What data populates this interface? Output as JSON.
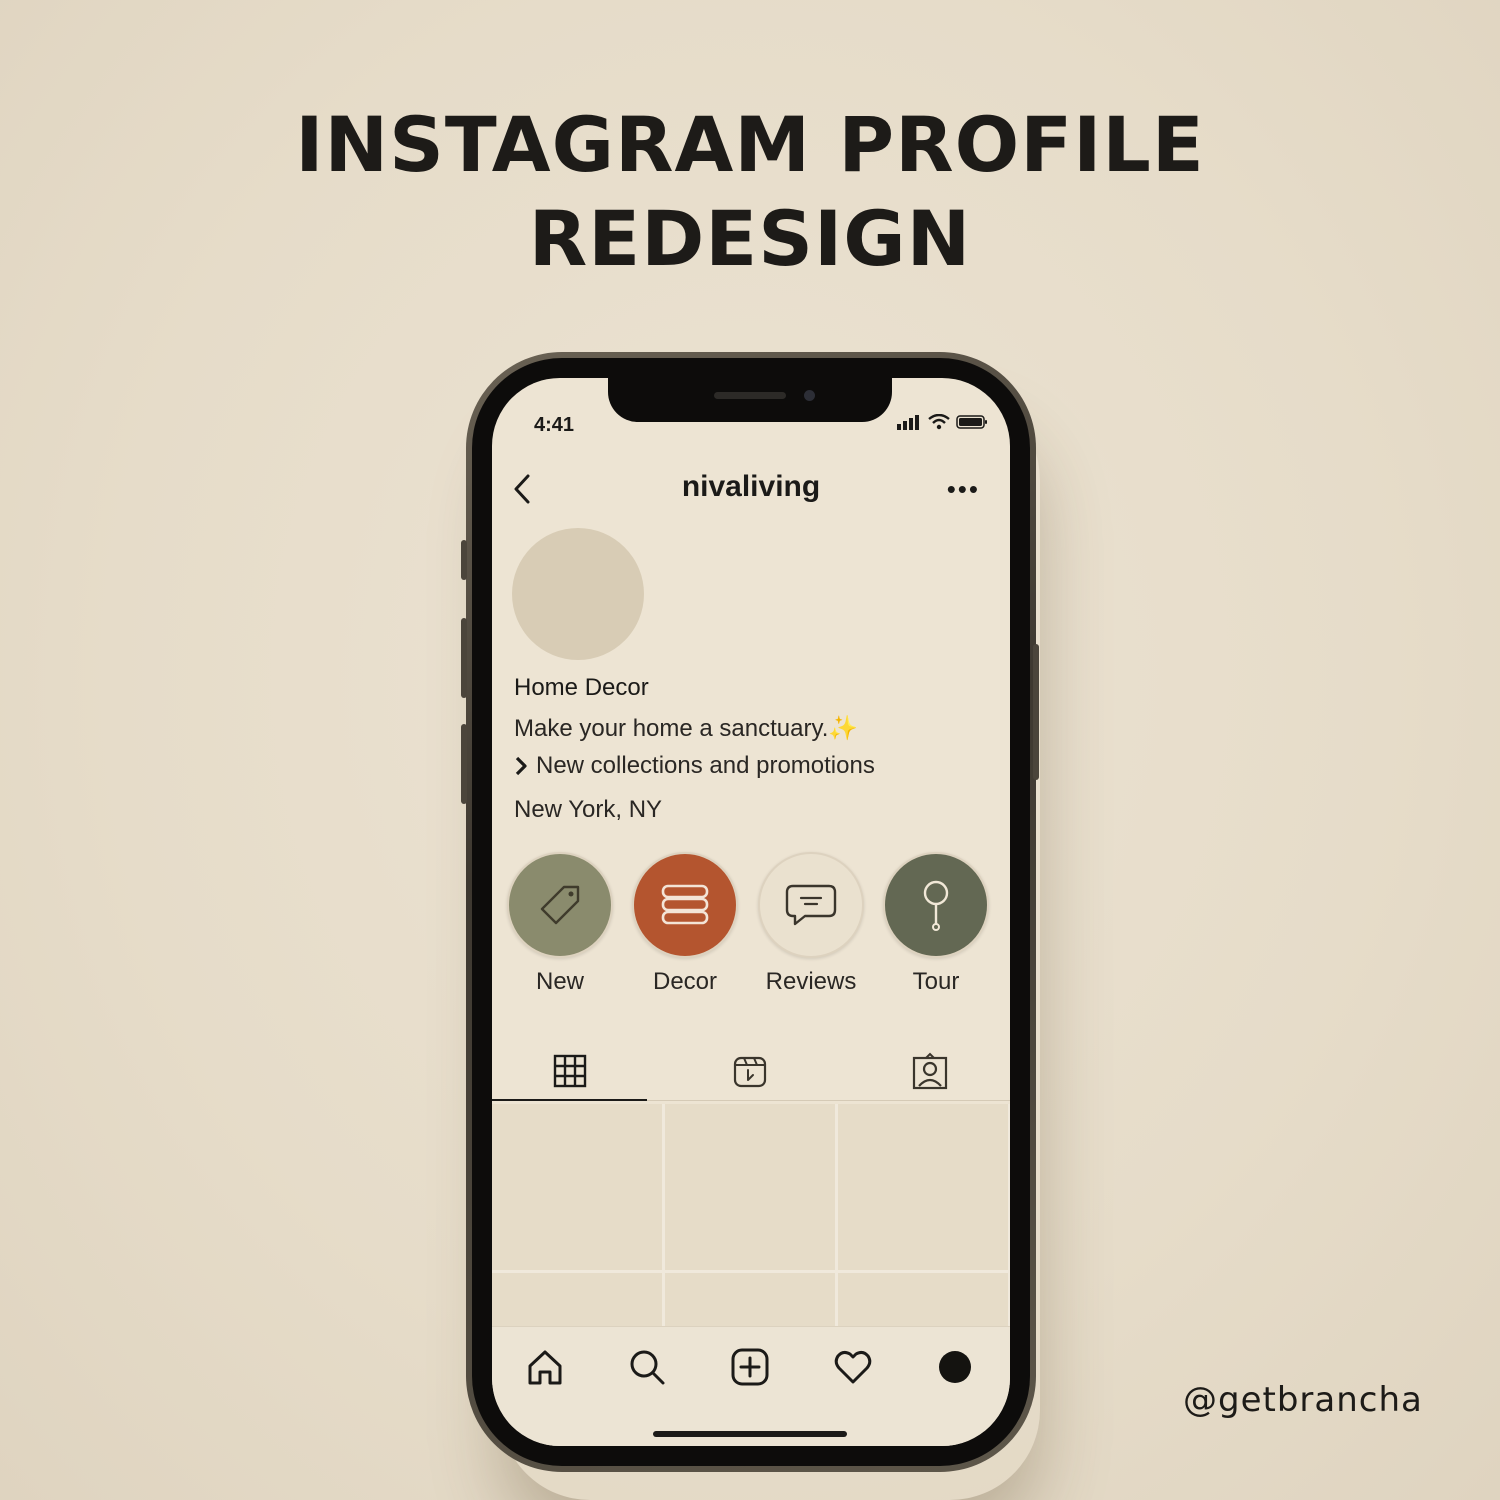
{
  "poster": {
    "headline_line1": "INSTAGRAM PROFILE",
    "headline_line2": "REDESIGN",
    "credit": "@getbrancha"
  },
  "status_bar": {
    "time": "4:41",
    "icons": [
      "cellular-signal-icon",
      "wifi-icon",
      "battery-icon"
    ]
  },
  "profile": {
    "username": "nivaliving",
    "nav_icons": [
      "back-chevron-icon",
      "more-options-icon"
    ],
    "bio": {
      "category": "Home Decor",
      "line1": "Make your home a sanctuary.",
      "line1_emoji": "✨",
      "link": "New collections and promotions",
      "location": "New York, NY"
    }
  },
  "highlights": [
    {
      "label": "New",
      "icon": "tag-icon",
      "color": "#8a8b6d"
    },
    {
      "label": "Decor",
      "icon": "stack-icon",
      "color": "#b4552f"
    },
    {
      "label": "Reviews",
      "icon": "chat-bubble-icon",
      "color": "#eae1cf"
    },
    {
      "label": "Tour",
      "icon": "pin-icon",
      "color": "#636853"
    }
  ],
  "tabs": [
    {
      "name": "grid",
      "icon": "grid-icon",
      "active": true
    },
    {
      "name": "reels",
      "icon": "reels-icon",
      "active": false
    },
    {
      "name": "tagged",
      "icon": "tagged-person-icon",
      "active": false
    }
  ],
  "bottom_nav": [
    "home-icon",
    "search-icon",
    "create-icon",
    "heart-icon",
    "profile-dot-icon"
  ],
  "colors": {
    "background": "#e8dfce",
    "screen": "#ede4d3",
    "text": "#1b1a18"
  }
}
